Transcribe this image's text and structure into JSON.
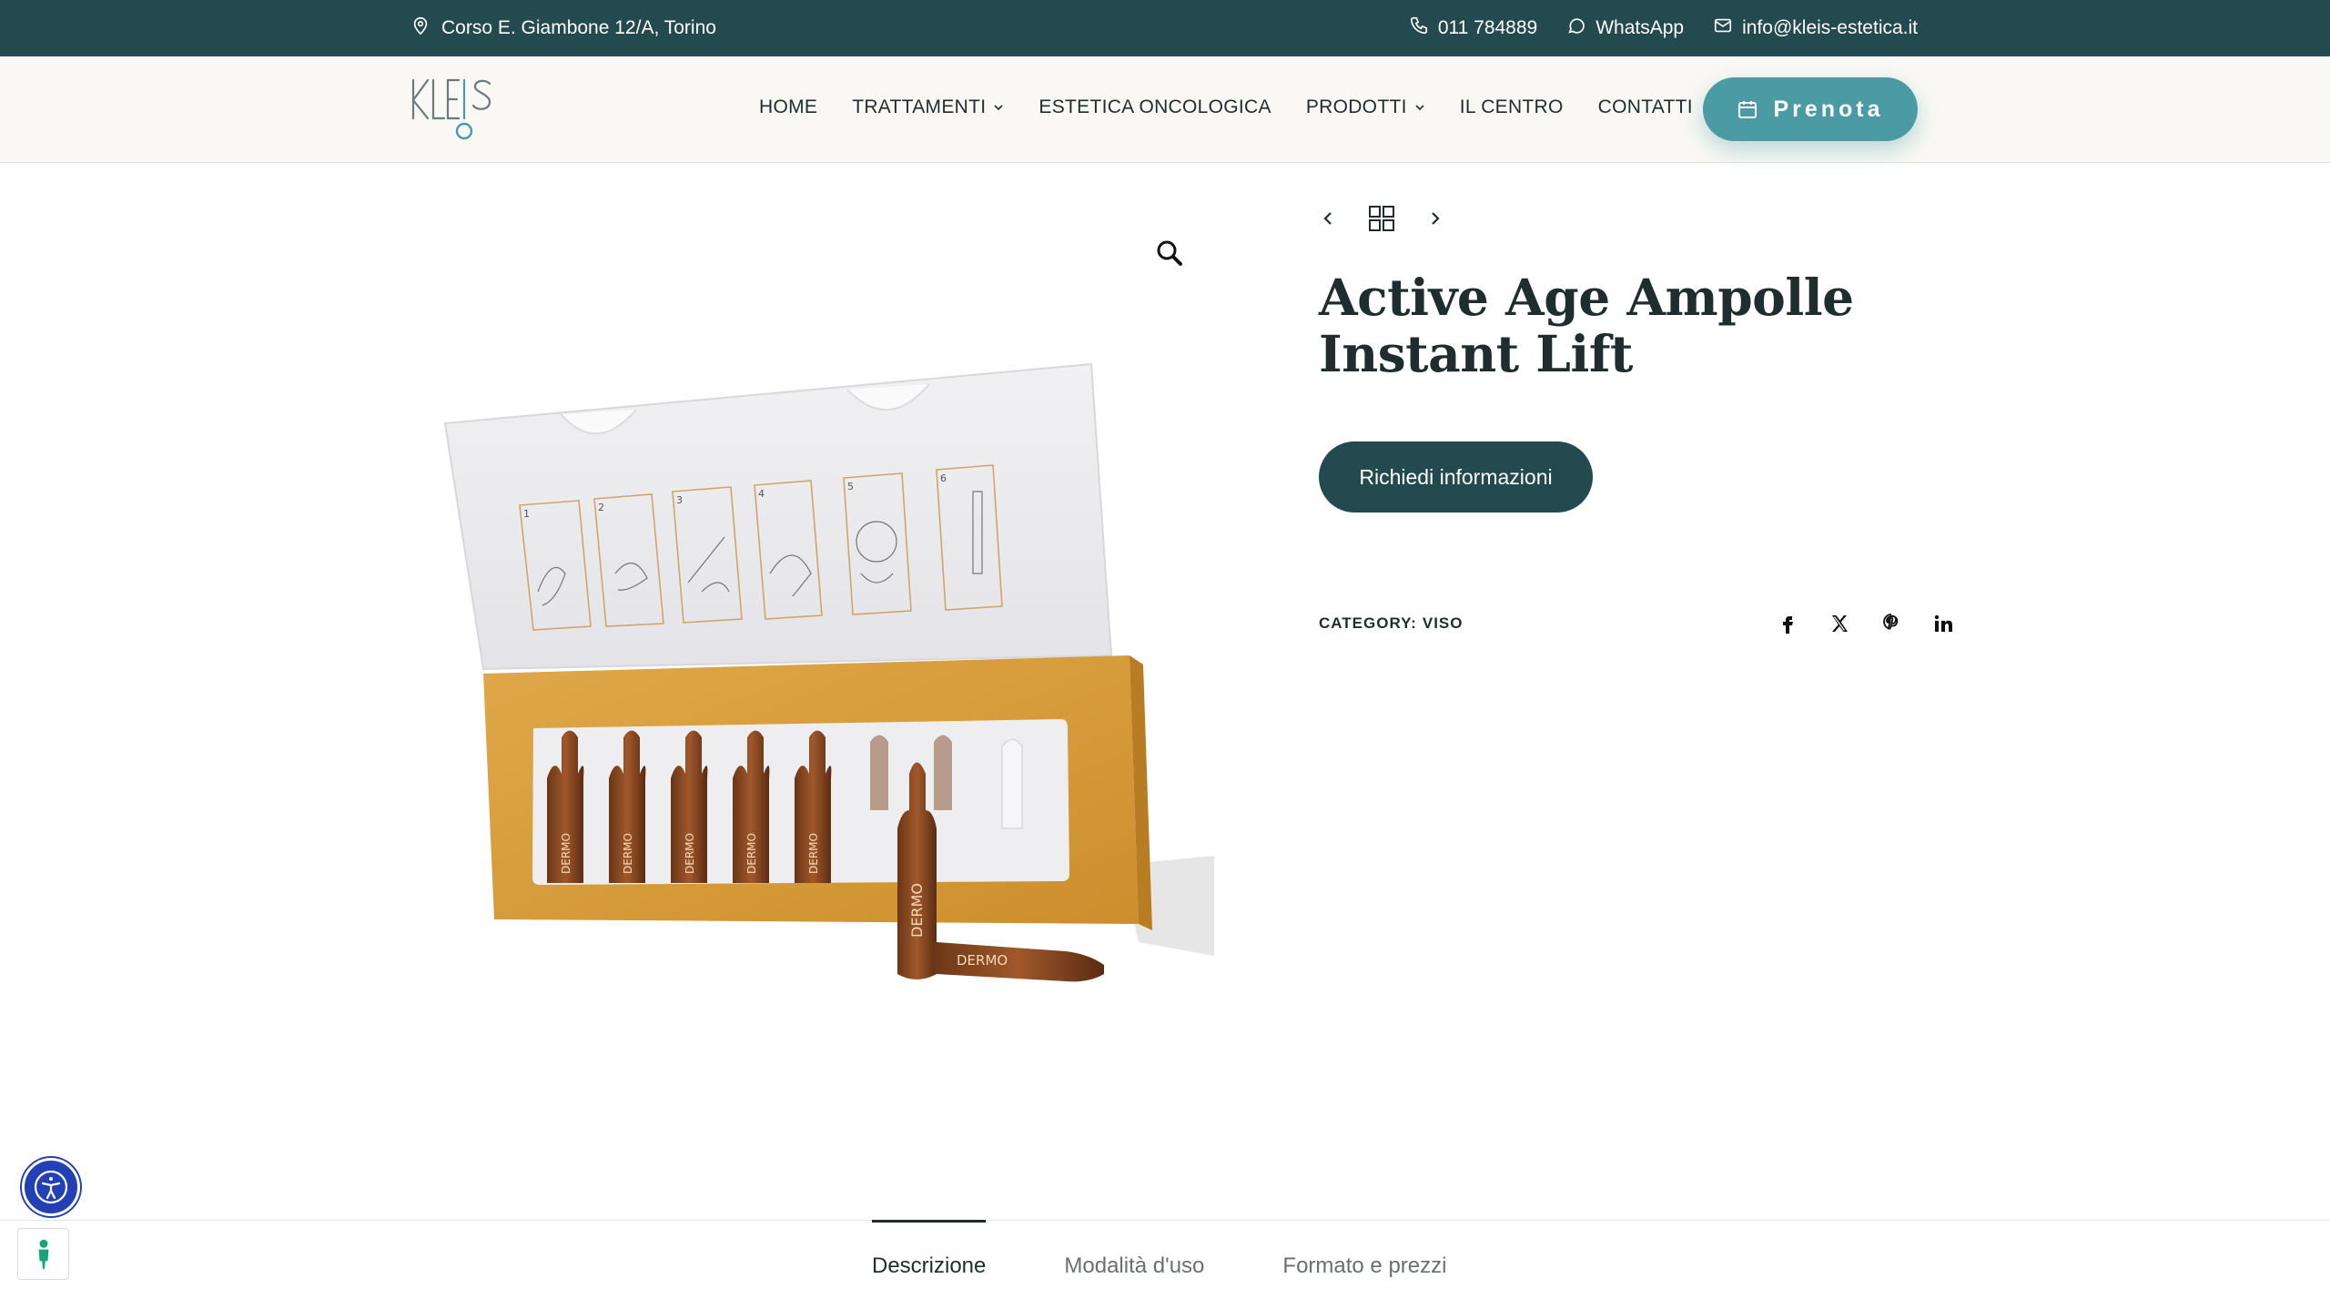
{
  "topbar": {
    "address": "Corso E. Giambone 12/A, Torino",
    "phone": "011 784889",
    "whatsapp": "WhatsApp",
    "email": "info@kleis-estetica.it"
  },
  "header": {
    "logo_text": "KLEIS",
    "nav": [
      {
        "label": "HOME",
        "has_dropdown": false
      },
      {
        "label": "TRATTAMENTI",
        "has_dropdown": true
      },
      {
        "label": "ESTETICA ONCOLOGICA",
        "has_dropdown": false
      },
      {
        "label": "PRODOTTI",
        "has_dropdown": true
      },
      {
        "label": "IL CENTRO",
        "has_dropdown": false
      },
      {
        "label": "CONTATTI",
        "has_dropdown": false
      }
    ],
    "book_label": "Prenota"
  },
  "product": {
    "title": "Active Age Ampolle Instant Lift",
    "info_button": "Richiedi informazioni",
    "category_label": "CATEGORY:",
    "category_value": "VISO",
    "image_steps": [
      "1",
      "2",
      "3",
      "4",
      "5",
      "6"
    ],
    "ampoule_brand": "DERMO"
  },
  "share": [
    "facebook-icon",
    "x-icon",
    "pinterest-icon",
    "linkedin-icon"
  ],
  "tabs": [
    {
      "label": "Descrizione",
      "active": true
    },
    {
      "label": "Modalità d'uso",
      "active": false
    },
    {
      "label": "Formato e prezzi",
      "active": false
    }
  ],
  "colors": {
    "topbar": "#234a4f",
    "accent": "#4a9ba3",
    "dark_button": "#234a4f",
    "box_gold": "#dca33f",
    "a11y_blue": "#2440b5"
  }
}
